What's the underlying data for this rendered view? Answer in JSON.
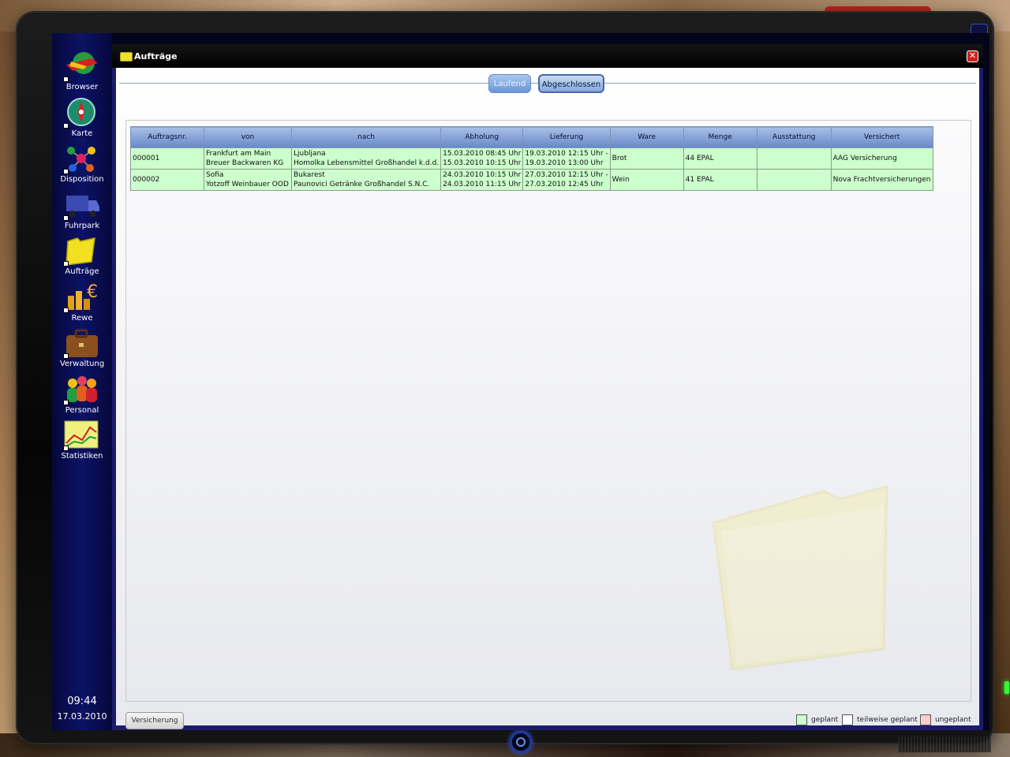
{
  "sidebar": {
    "items": [
      {
        "label": "Browser",
        "icon": "browser-icon"
      },
      {
        "label": "Karte",
        "icon": "compass-icon"
      },
      {
        "label": "Disposition",
        "icon": "molecule-icon"
      },
      {
        "label": "Fuhrpark",
        "icon": "truck-icon"
      },
      {
        "label": "Aufträge",
        "icon": "folder-icon"
      },
      {
        "label": "Rewe",
        "icon": "money-icon"
      },
      {
        "label": "Verwaltung",
        "icon": "briefcase-icon"
      },
      {
        "label": "Personal",
        "icon": "people-icon"
      },
      {
        "label": "Statistiken",
        "icon": "chart-icon"
      }
    ],
    "time": "09:44",
    "date": "17.03.2010"
  },
  "window": {
    "title": "Aufträge",
    "close": "✕",
    "tabs": {
      "laufend": "Laufend",
      "abgeschlossen": "Abgeschlossen"
    },
    "active_tab": "Abgeschlossen"
  },
  "table": {
    "headers": [
      "Auftragsnr.",
      "von",
      "nach",
      "Abholung",
      "Lieferung",
      "Ware",
      "Menge",
      "Ausstattung",
      "Versichert"
    ],
    "rows": [
      {
        "nr": "000001",
        "von_city": "Frankfurt am Main",
        "von_company": "Breuer Backwaren KG",
        "nach_city": "Ljubljana",
        "nach_company": "Homolka  Lebensmittel Großhandel k.d.d.",
        "abholung_from": "15.03.2010 08:45 Uhr",
        "abholung_to": "15.03.2010 10:15 Uhr",
        "lieferung_from": "19.03.2010 12:15 Uhr -",
        "lieferung_to": "19.03.2010 13:00 Uhr",
        "ware": "Brot",
        "menge": "44 EPAL",
        "ausstattung": "",
        "versichert": "AAG Versicherung"
      },
      {
        "nr": "000002",
        "von_city": "Sofia",
        "von_company": "Yotzoff Weinbauer OOD",
        "nach_city": "Bukarest",
        "nach_company": "Paunovici Getränke Großhandel S.N.C.",
        "abholung_from": "24.03.2010 10:15 Uhr",
        "abholung_to": "24.03.2010 11:15 Uhr",
        "lieferung_from": "27.03.2010 12:15 Uhr -",
        "lieferung_to": "27.03.2010 12:45 Uhr",
        "ware": "Wein",
        "menge": "41 EPAL",
        "ausstattung": "",
        "versichert": "Nova Frachtversicherungen"
      }
    ],
    "row_color": "#ccffcc"
  },
  "footer": {
    "button": "Versicherung",
    "legend": [
      {
        "label": "geplant",
        "color": "#ccffcc"
      },
      {
        "label": "teilweise geplant",
        "color": "#ffffff"
      },
      {
        "label": "ungeplant",
        "color": "#ffcccc"
      }
    ]
  }
}
